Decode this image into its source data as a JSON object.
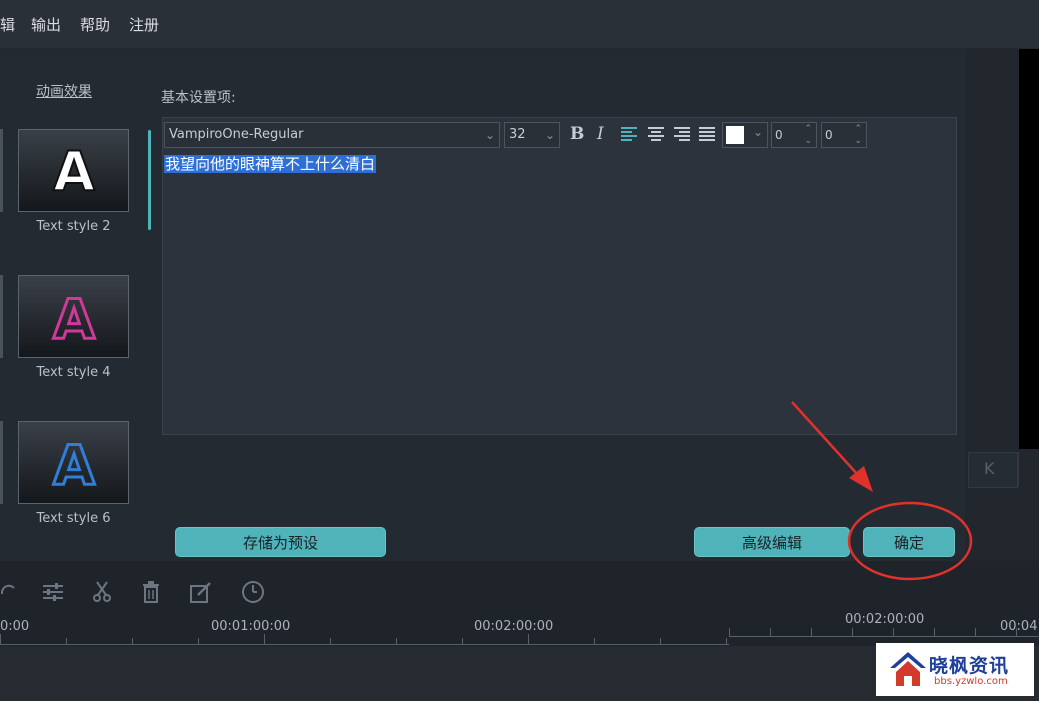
{
  "menu": {
    "items": [
      "辑",
      "输出",
      "帮助",
      "注册"
    ]
  },
  "left_panel": {
    "tab_label": "动画效果",
    "styles": [
      {
        "label": "Text style 2",
        "glyph": "A",
        "color": "#ffffff"
      },
      {
        "label": "Text style 4",
        "glyph": "A",
        "color": "#d0399a"
      },
      {
        "label": "Text style 6",
        "glyph": "A",
        "color": "#2f7fd6"
      }
    ]
  },
  "settings": {
    "section_label": "基本设置项:",
    "font_family": "VampiroOne-Regular",
    "font_size": "32",
    "bold_label": "B",
    "italic_label": "I",
    "spin1": "0",
    "spin2": "0",
    "text_color": "#ffffff",
    "content_text": "我望向他的眼神算不上什么清白"
  },
  "buttons": {
    "save_preset": "存储为预设",
    "advanced_edit": "高级编辑",
    "confirm": "确定"
  },
  "right_pane": {
    "k_label": "K"
  },
  "timeline": {
    "timecodes": [
      "0:00",
      "00:01:00:00",
      "00:02:00:00",
      "00:02:00:00",
      "00:04"
    ]
  },
  "watermark": {
    "title": "晓枫资讯",
    "url": "bbs.yzwlo.com"
  },
  "colors": {
    "accent": "#4fb3b9",
    "annotation": "#e0312b",
    "selection": "#2e6fd6"
  }
}
